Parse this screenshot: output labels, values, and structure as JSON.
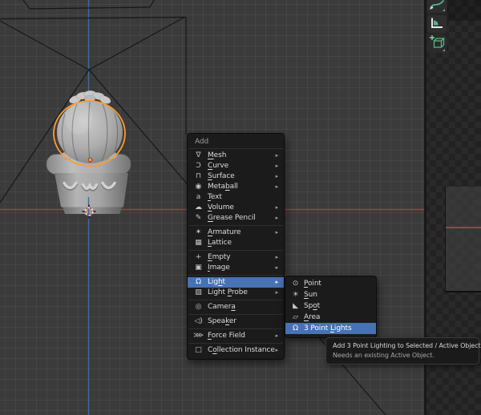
{
  "colors": {
    "highlight": "#4772b3",
    "selection_outline": "#ff9b30",
    "axis_x": "#9a4646",
    "axis_z": "#41699c",
    "tool_accent_green": "#56b483"
  },
  "viewport": {
    "selected_object": "cactus-in-pot",
    "overlays": [
      "x-axis-line",
      "z-axis-line",
      "grid",
      "3d-cursor",
      "object-origin",
      "light-cone-wireframe"
    ]
  },
  "toolbar": {
    "tools": [
      {
        "name": "annotate",
        "has_subtools": true
      },
      {
        "name": "measure",
        "has_subtools": false
      },
      {
        "name": "add-cube",
        "has_subtools": true
      }
    ]
  },
  "add_menu": {
    "title": "Add",
    "items": [
      {
        "label": "Mesh",
        "accel": 0,
        "icon": "mesh",
        "submenu": true
      },
      {
        "label": "Curve",
        "accel": 0,
        "icon": "curve",
        "submenu": true
      },
      {
        "label": "Surface",
        "accel": 0,
        "icon": "surface",
        "submenu": true
      },
      {
        "label": "Metaball",
        "accel": 4,
        "icon": "metaball",
        "submenu": true
      },
      {
        "label": "Text",
        "accel": 0,
        "icon": "text",
        "submenu": false
      },
      {
        "label": "Volume",
        "accel": 0,
        "icon": "volume",
        "submenu": true
      },
      {
        "label": "Grease Pencil",
        "accel": 0,
        "icon": "grease-pencil",
        "submenu": true
      },
      {
        "separator": true
      },
      {
        "label": "Armature",
        "accel": 0,
        "icon": "armature",
        "submenu": true
      },
      {
        "label": "Lattice",
        "accel": 0,
        "icon": "lattice",
        "submenu": false
      },
      {
        "separator": true
      },
      {
        "label": "Empty",
        "accel": 0,
        "icon": "empty",
        "submenu": true
      },
      {
        "label": "Image",
        "accel": 0,
        "icon": "image",
        "submenu": true
      },
      {
        "separator": true
      },
      {
        "label": "Light",
        "accel": 3,
        "icon": "light",
        "submenu": true,
        "highlighted": true
      },
      {
        "label": "Light Probe",
        "accel": 6,
        "icon": "light-probe",
        "submenu": true
      },
      {
        "separator": true
      },
      {
        "label": "Camera",
        "accel": 5,
        "icon": "camera",
        "submenu": false
      },
      {
        "separator": true
      },
      {
        "label": "Speaker",
        "accel": 4,
        "icon": "speaker",
        "submenu": false
      },
      {
        "separator": true
      },
      {
        "label": "Force Field",
        "accel": 0,
        "icon": "force-field",
        "submenu": true
      },
      {
        "separator": true
      },
      {
        "label": "Collection Instance",
        "accel": 1,
        "icon": "collection-instance",
        "submenu": true
      }
    ]
  },
  "light_submenu": {
    "items": [
      {
        "label": "Point",
        "accel": 0,
        "icon": "light-point"
      },
      {
        "label": "Sun",
        "accel": 0,
        "icon": "light-sun"
      },
      {
        "label": "Spot",
        "accel": 2,
        "icon": "light-spot"
      },
      {
        "label": "Area",
        "accel": 0,
        "icon": "light-area"
      },
      {
        "label": "3 Point Lights",
        "accel": 8,
        "icon": "light-bulb",
        "highlighted": true
      }
    ]
  },
  "tooltip": {
    "line1": "Add 3 Point Lighting to Selected / Active Object",
    "line2": "Needs an existing Active Object."
  }
}
